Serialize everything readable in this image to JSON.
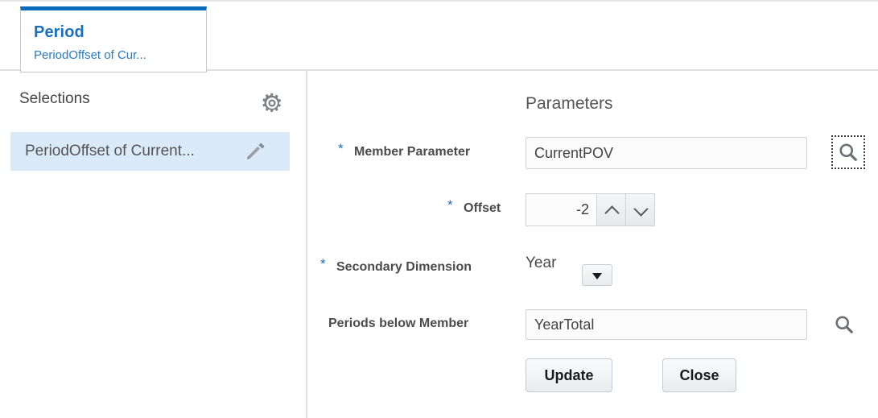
{
  "tab": {
    "title": "Period",
    "subtitle": "PeriodOffset of Cur...",
    "accent_color": "#0a6cbb"
  },
  "left_panel": {
    "header_label": "Selections",
    "gear_icon": "gear-icon",
    "items": [
      {
        "label": "PeriodOffset of Current...",
        "edit_icon": "pencil-icon",
        "selected": true,
        "highlight_color": "#dbeaf9"
      }
    ]
  },
  "right_panel": {
    "title": "Parameters",
    "fields": [
      {
        "label": "Member Parameter",
        "required": true,
        "required_marker": "*",
        "type": "text-with-search",
        "value": "CurrentPOV",
        "placeholder": "",
        "search_icon": "search-icon",
        "search_focused": true
      },
      {
        "label": "Offset",
        "required": true,
        "required_marker": "*",
        "type": "spinner",
        "value": "-2",
        "increment_icon": "chevron-up-icon",
        "decrement_icon": "chevron-down-icon"
      },
      {
        "label": "Secondary Dimension",
        "required": true,
        "required_marker": "*",
        "type": "dropdown",
        "value": "Year",
        "dropdown_icon": "caret-down-icon",
        "options": [
          "Year"
        ]
      },
      {
        "label": "Periods below Member",
        "required": false,
        "required_marker": "",
        "type": "text-with-search",
        "value": "YearTotal",
        "placeholder": "",
        "search_icon": "search-icon",
        "search_focused": false
      }
    ],
    "buttons": {
      "update_label": "Update",
      "close_label": "Close"
    }
  }
}
